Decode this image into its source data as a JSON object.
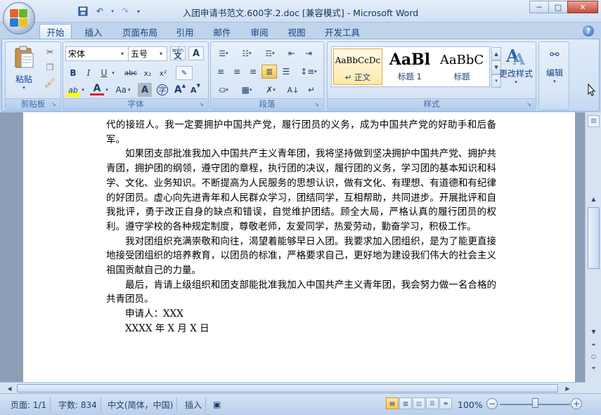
{
  "window": {
    "title": "入团申请书范文.600字.2.doc [兼容模式] - Microsoft Word",
    "minimize_icon": "minimize-icon",
    "maximize_icon": "maximize-icon",
    "close_icon": "close-icon"
  },
  "tabs": [
    {
      "label": "开始",
      "active": true
    },
    {
      "label": "插入"
    },
    {
      "label": "页面布局"
    },
    {
      "label": "引用"
    },
    {
      "label": "邮件"
    },
    {
      "label": "审阅"
    },
    {
      "label": "视图"
    },
    {
      "label": "开发工具"
    }
  ],
  "ribbon": {
    "clipboard": {
      "label": "剪贴板",
      "paste_label": "粘贴"
    },
    "font": {
      "label": "字体",
      "font_name": "宋体",
      "font_size": "五号",
      "wen_label": "wén",
      "bold": "B",
      "italic": "I",
      "underline": "U",
      "strike": "abc",
      "sub": "x₂",
      "sup": "x²",
      "clear_format": "Aa",
      "char_shade": "A",
      "grow_font": "A",
      "shrink_font": "A",
      "font_color": "A"
    },
    "paragraph": {
      "label": "段落"
    },
    "styles": {
      "label": "样式",
      "items": [
        {
          "sample": "AaBbCcDc",
          "name": "↵ 正文"
        },
        {
          "sample": "AaBl",
          "name": "标题 1"
        },
        {
          "sample": "AaBbC",
          "name": "标题"
        }
      ],
      "change_styles": "更改样式"
    },
    "editing": {
      "label": "编辑"
    }
  },
  "document": {
    "paragraphs": [
      "代的接班人。我一定要拥护中国共产党，履行团员的义务，成为中国共产党的好助手和后备军。",
      "　　如果团支部批准我加入中国共产主义青年团，我将坚持做到坚决拥护中国共产党、拥护共青团，拥护团的纲领，遵守团的章程，执行团的决议，履行团的义务，学习团的基本知识和科学、文化、业务知识。不断提高为人民服务的思想认识，做有文化、有理想、有道德和有纪律的好团员。虚心向先进青年和人民群众学习，团结同学，互相帮助，共同进步。开展批评和自我批评，勇于改正自身的缺点和错误，自觉维护团结。顾全大局，严格认真的履行团员的权利。遵守学校的各种规定制度，尊敬老师，友爱同学，热爱劳动，勤奋学习，积极工作。",
      "　　我对团组织充满崇敬和向往，渴望着能够早日入团。我要求加入团组织，是为了能更直接地接受团组织的培养教育，以团员的标准，严格要求自己，更好地为建设我们伟大的社会主义祖国贡献自己的力量。",
      "　　最后，肯请上级组织和团支部能批准我加入中国共产主义青年团，我会努力做一名合格的共青团员。",
      "　　申请人：XXX",
      "　　XXXX 年 X 月 X 日"
    ]
  },
  "statusbar": {
    "page": "页面: 1/1",
    "words": "字数: 834",
    "language": "中文(简体，中国)",
    "mode": "插入",
    "zoom": "100%",
    "zoom_level_percent": 100
  }
}
